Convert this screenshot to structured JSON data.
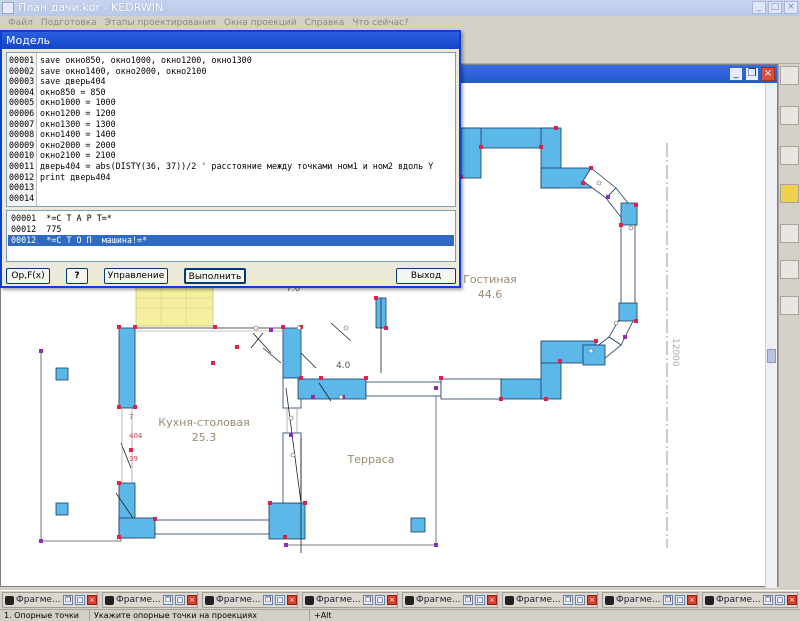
{
  "app": {
    "title": "План дачи.kdr - KEDRWIN"
  },
  "menu": {
    "items": [
      {
        "label": "Файл"
      },
      {
        "label": "Подготовка"
      },
      {
        "label": "Этапы проектирования"
      },
      {
        "label": "Окна проекций"
      },
      {
        "label": "Справка"
      },
      {
        "label": "Что сейчас?"
      }
    ]
  },
  "drawing": {
    "rooms": {
      "living_name": "Гостиная",
      "living_area": "44.6",
      "kitchen_name": "Кухня-столовая",
      "kitchen_area": "25.3",
      "terrace_name": "Терраса"
    },
    "dimensions": {
      "vertical": "12000",
      "door1": "404",
      "mark_small": "39",
      "mark_a": "4.0",
      "mark_b": "7.0",
      "mark_c": "7"
    }
  },
  "dialog": {
    "title": "Модель",
    "lines": [
      {
        "n": "00001",
        "code": "save окно850, окно1000, окно1200, окно1300"
      },
      {
        "n": "00002",
        "code": "save окно1400, окно2000, окно2100"
      },
      {
        "n": "00003",
        "code": "save дверь404"
      },
      {
        "n": "00004",
        "code": "окно850 = 850"
      },
      {
        "n": "00005",
        "code": "окно1000 = 1000"
      },
      {
        "n": "00006",
        "code": "окно1200 = 1200"
      },
      {
        "n": "00007",
        "code": "окно1300 = 1300"
      },
      {
        "n": "00008",
        "code": "окно1400 = 1400"
      },
      {
        "n": "00009",
        "code": "окно2000 = 2000"
      },
      {
        "n": "00010",
        "code": "окно2100 = 2100"
      },
      {
        "n": "00011",
        "code": "дверь404 = abs(DISTY(36, 37))/2 ' расстояние между точками ном1 и ном2 вдоль Y"
      },
      {
        "n": "00012",
        "code": "print дверь404"
      },
      {
        "n": "00013",
        "code": ""
      },
      {
        "n": "00014",
        "code": ""
      }
    ],
    "output": [
      {
        "text": "00001  *=С Т А Р Т=*"
      },
      {
        "text": "00012  775"
      },
      {
        "text": "00012  *=С Т О П  машина!=*"
      }
    ],
    "buttons": {
      "op": "Op,F(x)",
      "help": "?",
      "control": "Управление",
      "run": "Выполнить",
      "exit": "Выход"
    }
  },
  "taskbar": {
    "fragments": [
      {
        "label": "Фрагме..."
      },
      {
        "label": "Фрагме..."
      },
      {
        "label": "Фрагме..."
      },
      {
        "label": "Фрагме..."
      },
      {
        "label": "Фрагме..."
      },
      {
        "label": "Фрагме..."
      },
      {
        "label": "Фрагме..."
      },
      {
        "label": "Фрагме..."
      }
    ]
  },
  "status": {
    "mode": "1. Опорные точки",
    "hint": "Укажите опорные точки на проекциях",
    "key": "+Alt"
  },
  "colors": {
    "wall_fill": "#5bb8e8",
    "point_red": "#e0204a",
    "point_purple": "#8a2fb8",
    "room_label": "#9a8a70",
    "stairs": "#f4f0a0",
    "selection": "#316ac5"
  }
}
